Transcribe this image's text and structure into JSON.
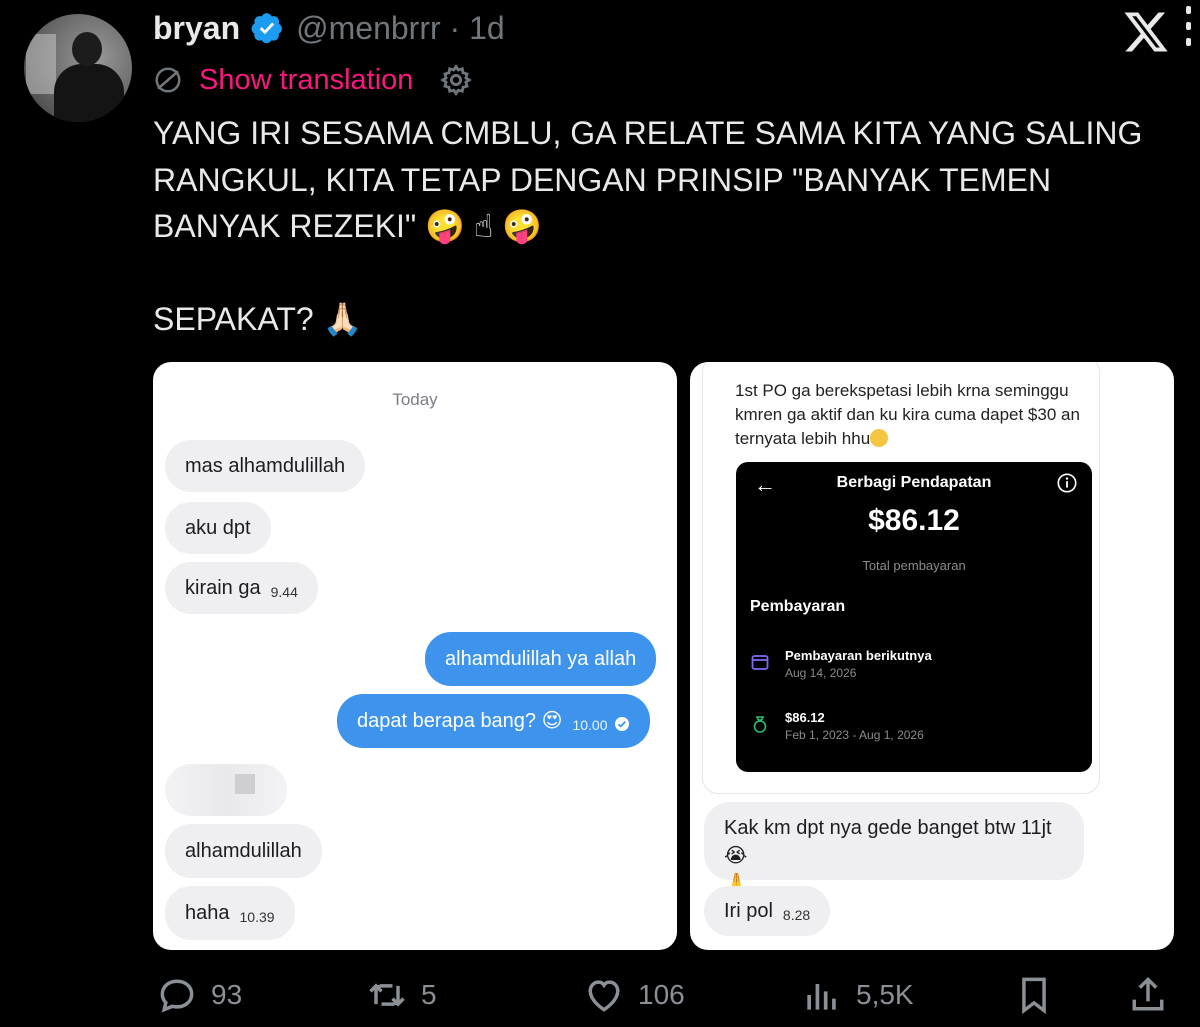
{
  "tweet": {
    "author": {
      "display_name": "bryan",
      "handle_line": "@menbrrr · 1d",
      "verified": true
    },
    "translate": {
      "label": "Show translation"
    },
    "text": "YANG IRI SESAMA CMBLU, GA RELATE SAMA KITA YANG SALING RANGKUL, KITA TETAP DENGAN PRINSIP \"BANYAK TEMEN BANYAK REZEKI\" 🤪 ☝ 🤪\n\nSEPAKAT? 🙏🏻"
  },
  "media_left": {
    "date_label": "Today",
    "messages": [
      {
        "text": "mas alhamdulillah",
        "time": ""
      },
      {
        "text": "aku dpt",
        "time": ""
      },
      {
        "text": "kirain ga",
        "time": "9.44"
      },
      {
        "text": "alhamdulillah ya allah",
        "time": ""
      },
      {
        "text": "dapat berapa bang? 😍",
        "time": "10.00"
      },
      {
        "text": "alhamdulillah",
        "time": ""
      },
      {
        "text": "haha",
        "time": "10.39"
      }
    ]
  },
  "media_right": {
    "message_text": "1st PO ga berekspetasi lebih krna seminggu kmren ga aktif dan ku kira cuma dapet $30 an ternyata lebih hhu",
    "earnings": {
      "title": "Berbagi Pendapatan",
      "amount": "$86.12",
      "total_label": "Total pembayaran",
      "section": "Pembayaran",
      "next_payout_label": "Pembayaran berikutnya",
      "next_payout_date": "Aug 14, 2026",
      "payout_amount": "$86.12",
      "payout_range": "Feb 1, 2023 - Aug 1, 2026"
    },
    "reply1": "Kak km dpt nya gede banget btw 11jt 😭",
    "reply1_emoji": "🙏",
    "reply2": {
      "text": "Iri pol",
      "time": "8.28"
    }
  },
  "actions": {
    "replies": "93",
    "reposts": "5",
    "likes": "106",
    "views": "5,5K"
  },
  "colors": {
    "accent_pink": "#f91880",
    "verified_blue": "#1d9bf0",
    "outgoing_bubble": "#3e94ec",
    "muted": "#71767b"
  }
}
